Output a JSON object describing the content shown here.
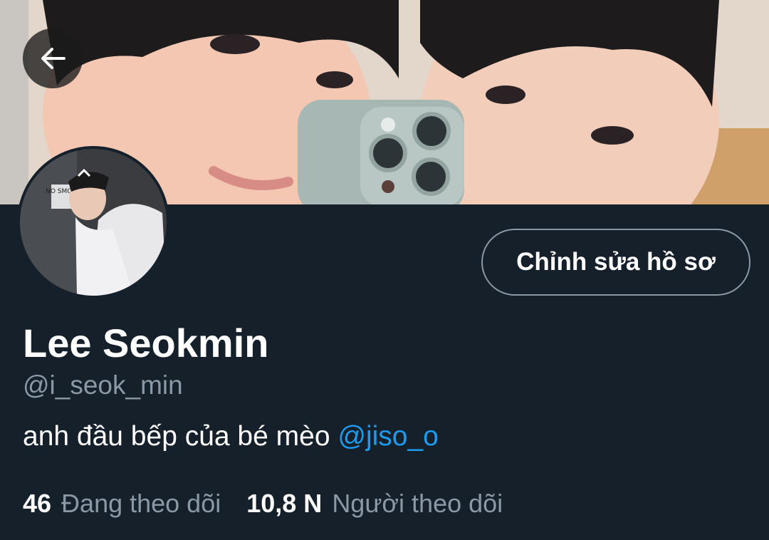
{
  "header": {
    "back_icon": "arrow-left-icon"
  },
  "profile": {
    "edit_button_label": "Chỉnh sửa hồ sơ",
    "display_name": "Lee Seokmin",
    "handle": "@i_seok_min",
    "bio_text": "anh đầu bếp của bé mèo ",
    "bio_mention": "@jiso_o",
    "avatar_sign_text": "NO SMOKI"
  },
  "stats": {
    "following_count": "46",
    "following_label": "Đang theo dõi",
    "followers_count": "10,8 N",
    "followers_label": "Người theo dõi"
  },
  "colors": {
    "background": "#15202b",
    "text_primary": "#ffffff",
    "text_secondary": "#8b98a5",
    "accent": "#1d9bf0",
    "button_border": "#8b98a5"
  }
}
